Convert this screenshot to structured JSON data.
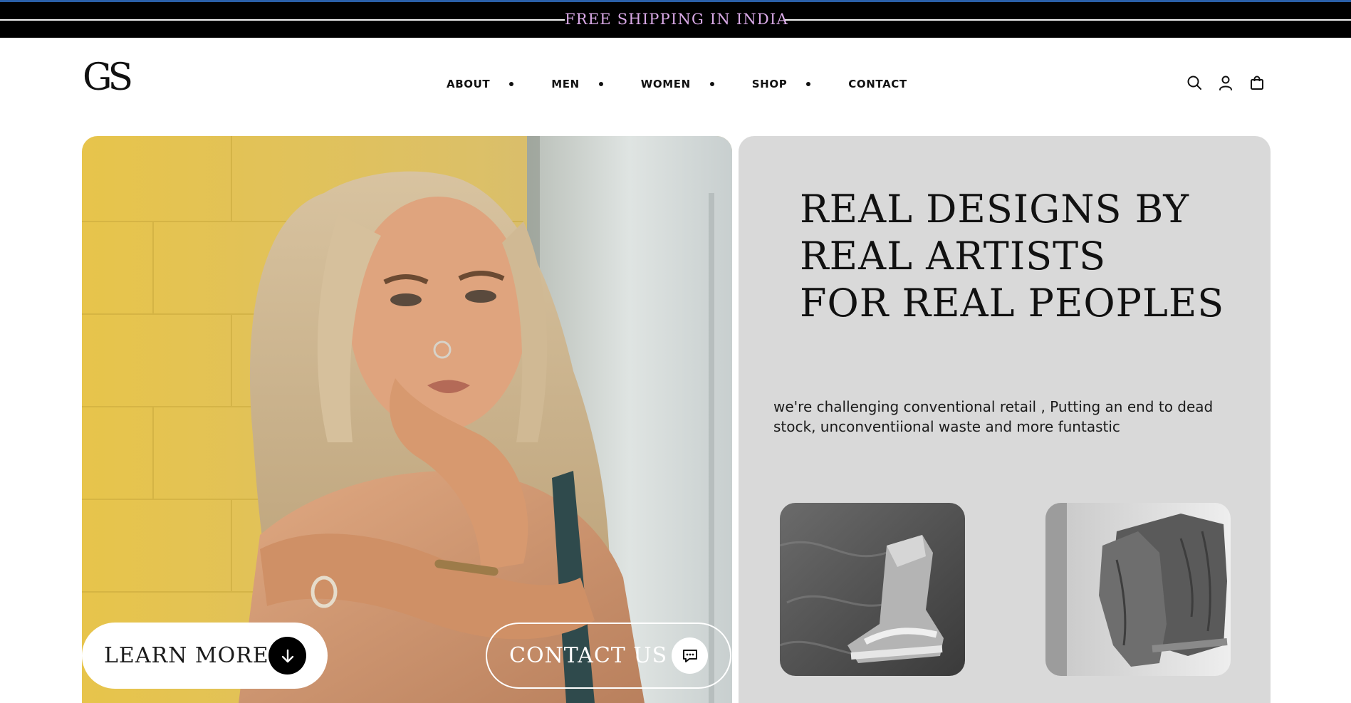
{
  "announcement": {
    "text": "FREE SHIPPING IN INDIA"
  },
  "header": {
    "logo": "GS",
    "nav": [
      {
        "label": "ABOUT"
      },
      {
        "label": "MEN"
      },
      {
        "label": "WOMEN"
      },
      {
        "label": "SHOP"
      },
      {
        "label": "CONTACT"
      }
    ],
    "icons": [
      "search-icon",
      "account-icon",
      "cart-bag-icon"
    ]
  },
  "hero": {
    "learn_more": "LEARN MORE",
    "contact_us": "CONTACT US",
    "headline": [
      "REAL DESIGNS BY",
      "REAL ARTISTS",
      "FOR REAL PEOPLES"
    ],
    "subcopy": "we're challenging conventional retail , Putting an end to dead stock, unconventiional waste and more funtastic"
  },
  "colors": {
    "topbar_bg": "#000000",
    "topbar_accent": "#2a5fa8",
    "announcement_text": "#d9a9e6",
    "panel_gray": "#d9d9d9",
    "photo_yellow": "#e6c64e"
  }
}
